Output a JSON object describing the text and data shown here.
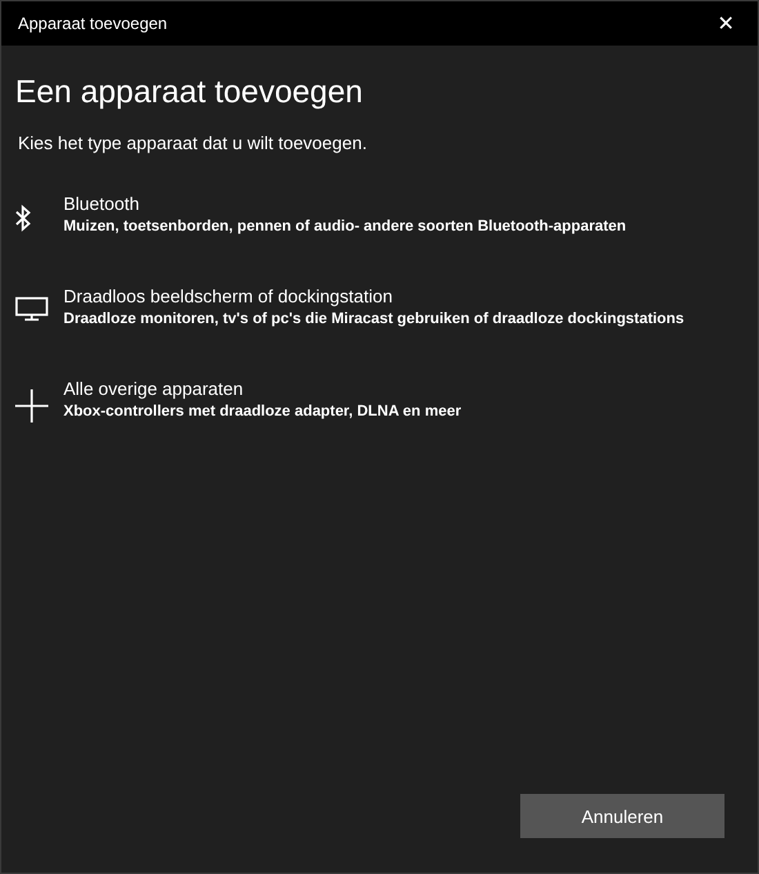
{
  "window": {
    "title": "Apparaat toevoegen",
    "close": "✕"
  },
  "heading": "Een apparaat toevoegen",
  "intro": "Kies het type apparaat dat u wilt toevoegen.",
  "options": [
    {
      "kind": "bluetooth",
      "title": "Bluetooth",
      "description": "Muizen, toetsenborden, pennen of audio- andere soorten Bluetooth-apparaten"
    },
    {
      "kind": "display",
      "title": "Draadloos beeldscherm of dockingstation",
      "description": "Draadloze monitoren, tv's of pc's die Miracast gebruiken of draadloze dockingstations"
    },
    {
      "kind": "other",
      "title": "Alle overige apparaten",
      "description": "Xbox-controllers met draadloze adapter, DLNA en meer"
    }
  ],
  "buttons": [
    "Annuleren"
  ]
}
